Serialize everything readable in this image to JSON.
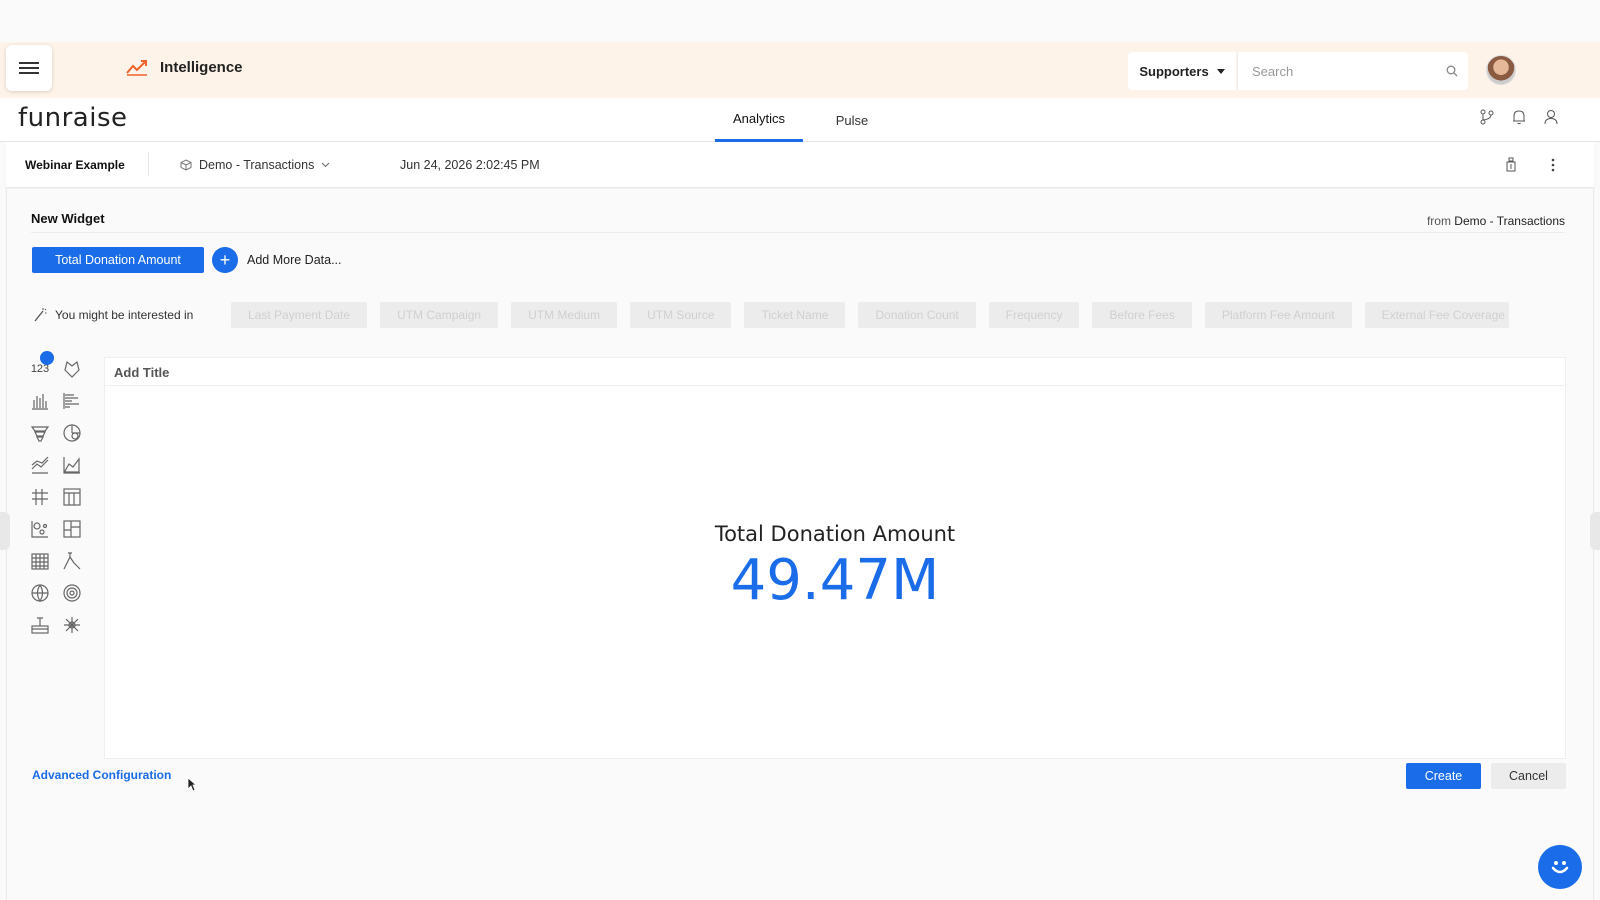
{
  "app": {
    "name": "Intelligence",
    "logo_text": "funraise"
  },
  "header": {
    "supporters_label": "Supporters",
    "search_placeholder": "Search"
  },
  "tabs": [
    {
      "label": "Analytics",
      "active": true
    },
    {
      "label": "Pulse",
      "active": false
    }
  ],
  "subheader": {
    "dashboard_name": "Webinar Example",
    "datasource": "Demo - Transactions",
    "timestamp": "Jun 24, 2026 2:02:45 PM"
  },
  "widget_editor": {
    "title": "New Widget",
    "from_label": "from",
    "from_source": "Demo - Transactions",
    "selected_measure": "Total Donation Amount",
    "add_more_label": "Add More Data...",
    "suggestions_label": "You might be interested in",
    "suggestions": [
      "Last Payment Date",
      "UTM Campaign",
      "UTM Medium",
      "UTM Source",
      "Ticket Name",
      "Donation Count",
      "Frequency",
      "Before Fees",
      "Platform Fee Amount",
      "External Fee Coverage"
    ],
    "chart_types": [
      "indicator-123",
      "polar-icon",
      "column-chart-icon",
      "bar-chart-icon",
      "funnel-chart-icon",
      "pie-chart-icon",
      "line-chart-icon",
      "area-chart-icon",
      "table-icon",
      "pivot-table-icon",
      "scatter-chart-icon",
      "treemap-icon",
      "calendar-heatmap-icon",
      "boxplot-icon",
      "scatter-map-icon",
      "sunburst-icon",
      "blox-icon",
      "tabber-icon"
    ],
    "chart_indicator_label": "123",
    "title_placeholder": "Add Title",
    "kpi_label": "Total Donation Amount",
    "kpi_value": "49.47M",
    "advanced_label": "Advanced Configuration",
    "create_label": "Create",
    "cancel_label": "Cancel"
  },
  "colors": {
    "accent": "#1a6ce8",
    "appbar": "#fdf3e8"
  }
}
